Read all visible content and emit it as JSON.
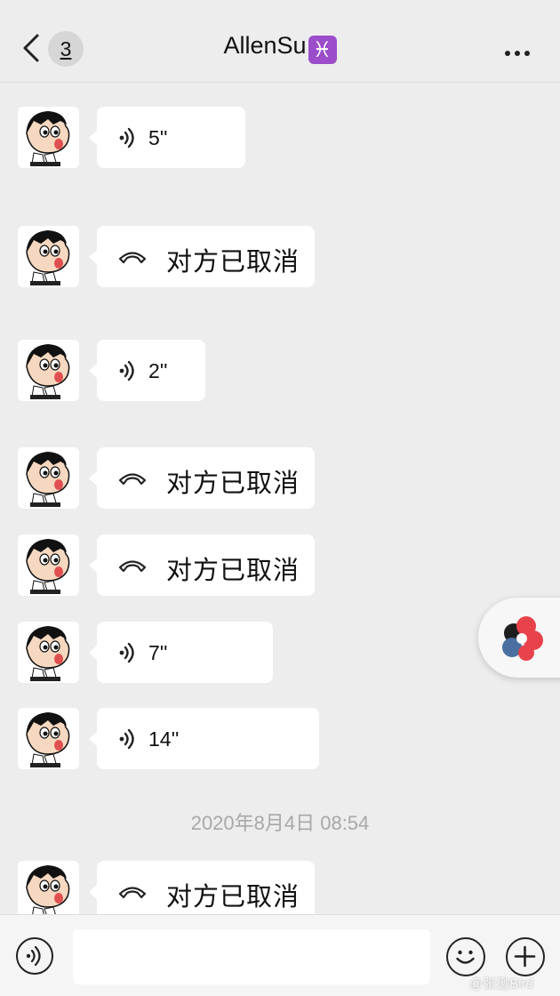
{
  "header": {
    "back_badge": "3",
    "title": "AllenSu",
    "title_symbol": "♓"
  },
  "messages": [
    {
      "type": "voice",
      "duration": "5''"
    },
    {
      "type": "call",
      "text": "对方已取消"
    },
    {
      "type": "voice",
      "duration": "2''"
    },
    {
      "type": "call",
      "text": "对方已取消"
    },
    {
      "type": "call",
      "text": "对方已取消"
    },
    {
      "type": "voice",
      "duration": "7''"
    },
    {
      "type": "voice",
      "duration": "14''"
    },
    {
      "type": "call",
      "text": "对方已取消"
    }
  ],
  "timestamp": "2020年8月4日 08:54",
  "watermark": "@张逊Bird",
  "colors": {
    "background": "#ededed",
    "bubble": "#ffffff",
    "title_symbol_bg": "#9b4dca"
  },
  "icons": [
    "back-icon",
    "more-icon",
    "voice-icon",
    "phone-hangup-icon",
    "emoji-icon",
    "plus-icon"
  ]
}
